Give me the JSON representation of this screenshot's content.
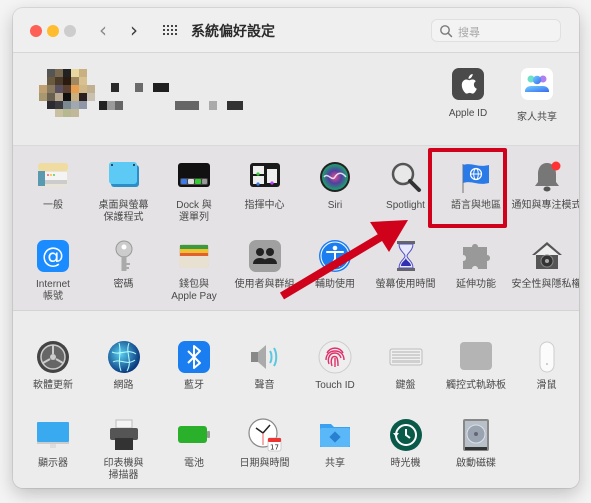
{
  "window": {
    "title": "系統偏好設定",
    "search_placeholder": "搜尋"
  },
  "account": {
    "items": [
      {
        "label": "Apple ID",
        "icon": "apple-logo-icon"
      },
      {
        "label": "家人共享",
        "icon": "family-sharing-icon"
      }
    ]
  },
  "section1": {
    "row1": [
      {
        "label": "一般",
        "icon": "general-icon"
      },
      {
        "label": "桌面與螢幕\n保護程式",
        "icon": "desktop-screensaver-icon"
      },
      {
        "label": "Dock 與\n選單列",
        "icon": "dock-icon"
      },
      {
        "label": "指揮中心",
        "icon": "mission-control-icon"
      },
      {
        "label": "Siri",
        "icon": "siri-icon"
      },
      {
        "label": "Spotlight",
        "icon": "spotlight-icon"
      },
      {
        "label": "語言與地區",
        "icon": "language-region-icon"
      },
      {
        "label": "通知與專注模式",
        "icon": "notifications-icon"
      }
    ],
    "row2": [
      {
        "label": "Internet\n帳號",
        "icon": "internet-accounts-icon"
      },
      {
        "label": "密碼",
        "icon": "passwords-icon"
      },
      {
        "label": "錢包與\nApple Pay",
        "icon": "wallet-icon"
      },
      {
        "label": "使用者與群組",
        "icon": "users-groups-icon"
      },
      {
        "label": "輔助使用",
        "icon": "accessibility-icon"
      },
      {
        "label": "螢幕使用時間",
        "icon": "screen-time-icon"
      },
      {
        "label": "延伸功能",
        "icon": "extensions-icon"
      },
      {
        "label": "安全性與隱私權",
        "icon": "security-privacy-icon"
      }
    ]
  },
  "section2": {
    "row1": [
      {
        "label": "軟體更新",
        "icon": "software-update-icon"
      },
      {
        "label": "網路",
        "icon": "network-icon"
      },
      {
        "label": "藍牙",
        "icon": "bluetooth-icon"
      },
      {
        "label": "聲音",
        "icon": "sound-icon"
      },
      {
        "label": "Touch ID",
        "icon": "touch-id-icon"
      },
      {
        "label": "鍵盤",
        "icon": "keyboard-icon"
      },
      {
        "label": "觸控式軌跡板",
        "icon": "trackpad-icon"
      },
      {
        "label": "滑鼠",
        "icon": "mouse-icon"
      }
    ],
    "row2": [
      {
        "label": "顯示器",
        "icon": "displays-icon"
      },
      {
        "label": "印表機與\n掃描器",
        "icon": "printers-scanners-icon"
      },
      {
        "label": "電池",
        "icon": "battery-icon"
      },
      {
        "label": "日期與時間",
        "icon": "date-time-icon"
      },
      {
        "label": "共享",
        "icon": "sharing-icon"
      },
      {
        "label": "時光機",
        "icon": "time-machine-icon"
      },
      {
        "label": "啟動磁碟",
        "icon": "startup-disk-icon"
      }
    ]
  },
  "annotation": {
    "highlight_target": "語言與地區",
    "color": "#d0021b"
  },
  "calendar_day": "17"
}
